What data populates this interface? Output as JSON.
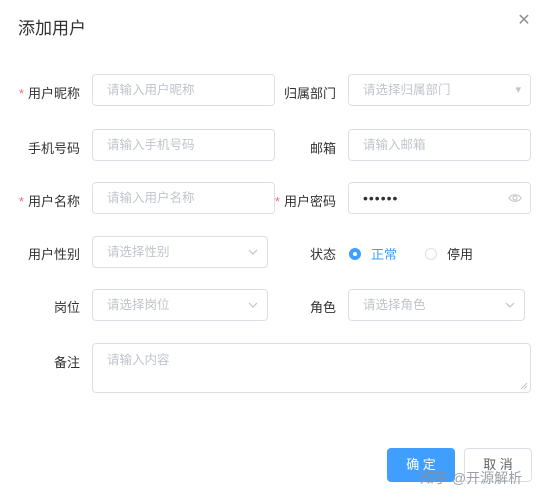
{
  "dialog": {
    "title": "添加用户",
    "close_icon": "close-icon"
  },
  "form": {
    "nickname": {
      "label": "用户昵称",
      "required": "*",
      "placeholder": "请输入用户昵称"
    },
    "dept": {
      "label": "归属部门",
      "placeholder": "请选择归属部门"
    },
    "phone": {
      "label": "手机号码",
      "placeholder": "请输入手机号码"
    },
    "email": {
      "label": "邮箱",
      "placeholder": "请输入邮箱"
    },
    "username": {
      "label": "用户名称",
      "required": "*",
      "placeholder": "请输入用户名称"
    },
    "password": {
      "label": "用户密码",
      "required": "*",
      "value": "••••••"
    },
    "sex": {
      "label": "用户性别",
      "placeholder": "请选择性别"
    },
    "status": {
      "label": "状态",
      "options": [
        "正常",
        "停用"
      ],
      "selected": "正常"
    },
    "post": {
      "label": "岗位",
      "placeholder": "请选择岗位"
    },
    "role": {
      "label": "角色",
      "placeholder": "请选择角色"
    },
    "remark": {
      "label": "备注",
      "placeholder": "请输入内容"
    }
  },
  "footer": {
    "confirm_label": "确 定",
    "cancel_label": "取 消"
  },
  "watermark": "知乎 @开源解析",
  "colors": {
    "primary": "#409eff",
    "required": "#f56c6c",
    "border": "#dcdfe6"
  }
}
